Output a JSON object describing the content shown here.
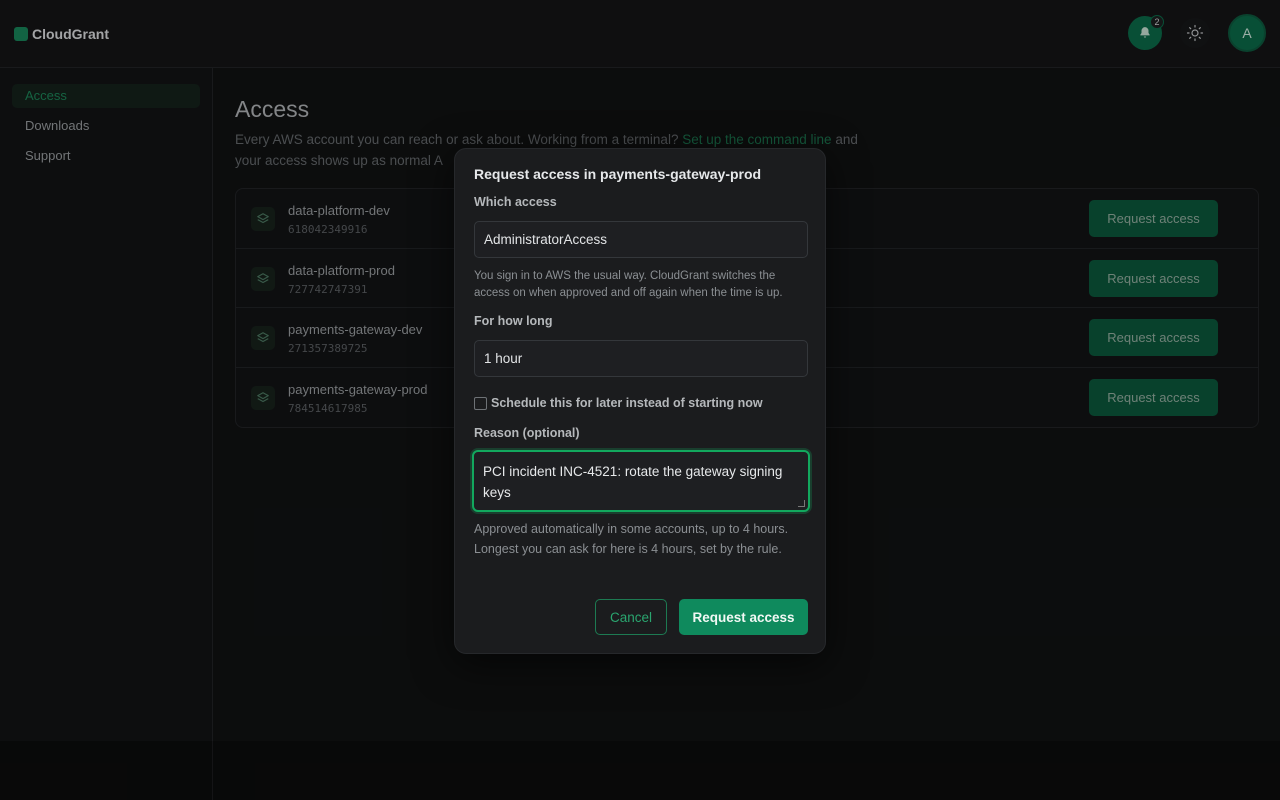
{
  "app": {
    "brand": "CloudGrant",
    "notification_count": "2",
    "avatar_initial": "A",
    "accent_color": "#0f8a5d"
  },
  "sidebar": {
    "items": [
      {
        "label": "Access",
        "active": true
      },
      {
        "label": "Downloads",
        "active": false
      },
      {
        "label": "Support",
        "active": false
      }
    ]
  },
  "main": {
    "title": "Access",
    "subtitle_before": "Every AWS account you can reach or ask about. Working from a terminal?",
    "subtitle_link": "Set up the command line",
    "subtitle_after": " and",
    "subtitle_line2": "your access shows up as normal A"
  },
  "accounts": [
    {
      "name": "data-platform-dev",
      "id": "618042349916",
      "button": "Request access"
    },
    {
      "name": "data-platform-prod",
      "id": "727742747391",
      "button": "Request access"
    },
    {
      "name": "payments-gateway-dev",
      "id": "271357389725",
      "button": "Request access"
    },
    {
      "name": "payments-gateway-prod",
      "id": "784514617985",
      "button": "Request access"
    }
  ],
  "modal": {
    "title": "Request access in payments-gateway-prod",
    "which_label": "Which access",
    "which_value": "AdministratorAccess",
    "which_help": "You sign in to AWS the usual way. CloudGrant switches the access on when approved and off again when the time is up.",
    "duration_label": "For how long",
    "duration_value": "1 hour",
    "schedule_label": "Schedule this for later instead of starting now",
    "reason_label": "Reason (optional)",
    "reason_value": "PCI incident INC-4521: rotate the gateway signing keys",
    "approval_info": "Approved automatically in some accounts, up to 4 hours. Longest you can ask for here is 4 hours, set by the rule.",
    "cancel_label": "Cancel",
    "submit_label": "Request access"
  }
}
